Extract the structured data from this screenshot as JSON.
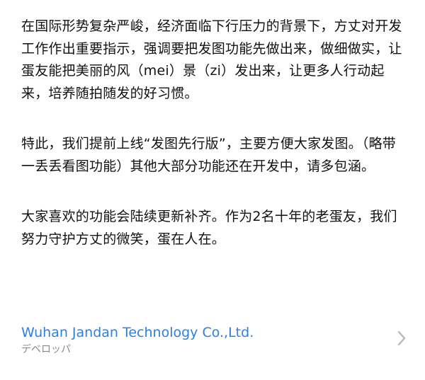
{
  "description": {
    "paragraphs": [
      "在国际形势复杂严峻，经济面临下行压力的背景下，方丈对开发工作作出重要指示，强调要把发图功能先做出来，做细做实，让蛋友能把美丽的风（mei）景（zi）发出来，让更多人行动起来，培养随拍随发的好习惯。",
      "特此，我们提前上线“发图先行版”，主要方便大家发图。（略带一丢丢看图功能）其他大部分功能还在开发中，请多包涵。",
      "大家喜欢的功能会陆续更新补齐。作为2名十年的老蛋友，我们努力守护方丈的微笑，蛋在人在。"
    ]
  },
  "developer": {
    "name": "Wuhan Jandan Technology Co.,Ltd.",
    "caption": "デベロッパ",
    "chevron_icon": "chevron-right-icon",
    "link_color": "#2f7fde"
  }
}
